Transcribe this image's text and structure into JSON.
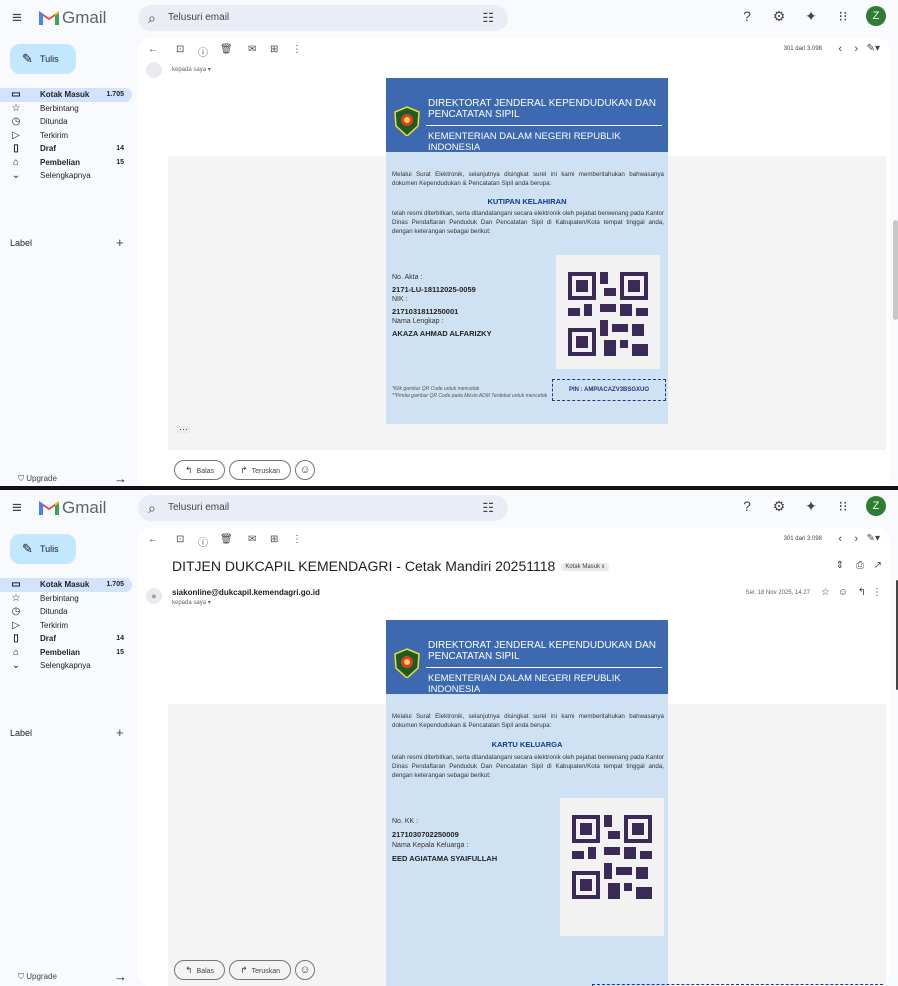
{
  "app": {
    "brand": "Gmail",
    "search_placeholder": "Telusuri email",
    "avatar_letter": "Z",
    "accent": "#c2e7ff",
    "card_blue": "#3d69b1",
    "card_bg": "#cfe2f3"
  },
  "sidebar": {
    "compose": "Tulis",
    "items": [
      {
        "label": "Kotak Masuk",
        "count": "1.705",
        "icon": "inbox-icon"
      },
      {
        "label": "Berbintang",
        "count": "",
        "icon": "star-icon"
      },
      {
        "label": "Ditunda",
        "count": "",
        "icon": "clock-icon"
      },
      {
        "label": "Terkirim",
        "count": "",
        "icon": "send-icon"
      },
      {
        "label": "Draf",
        "count": "14",
        "icon": "draft-icon"
      },
      {
        "label": "Pembelian",
        "count": "15",
        "icon": "shopping-bag-icon"
      },
      {
        "label": "Selengkapnya",
        "count": "",
        "icon": "chevron-down-icon"
      }
    ],
    "label_heading": "Label",
    "upgrade": "Upgrade"
  },
  "toolbar": {
    "pager": "301 dari 3.098"
  },
  "pane1": {
    "sender_to": "kepada saya ▾",
    "card": {
      "title": "DIREKTORAT JENDERAL KEPENDUDUKAN DAN PENCATATAN SIPIL",
      "subtitle": "KEMENTERIAN DALAM NEGERI REPUBLIK INDONESIA",
      "intro": "Melalui Surat Elektronik, selanjutnya disingkat surel ini kami memberitahukan bahwasanya dokumen Kependudukan & Pencatatan Sipil anda berupa:",
      "doc_type": "KUTIPAN KELAHIRAN",
      "body": "telah resmi diterbitkan, serta ditandatangani secara elektronik oleh pejabat berwenang pada Kantor Dinas Pendaftaran Penduduk Dan Pencatatan Sipil di Kabupaten/Kota tempat tinggal anda, dengan keterangan sebagai berikut:",
      "f1_label": "No. Akta :",
      "f1_value": "2171-LU-18112025-0059",
      "f2_label": "NIK :",
      "f2_value": "2171031811250001",
      "f3_label": "Nama Lengkap :",
      "f3_value": "AKAZA AHMAD ALFARIZKY",
      "note1": "*Klik gambar QR Code untuk mencetak",
      "note2": "**Pindai gambar QR Code pada Mesin ADM Terdekat untuk mencetak",
      "pin": "PIN : AMPIACAZV3BSGXUO"
    },
    "reply": "Balas",
    "forward": "Teruskan"
  },
  "pane2": {
    "subject": "DITJEN DUKCAPIL KEMENDAGRI - Cetak Mandiri 20251118",
    "badge": "Kotak Masuk x",
    "sender": "siakonline@dukcapil.kemendagri.go.id",
    "sender_to": "kepada saya ▾",
    "date": "Sel, 18 Nov 2025, 14.27",
    "card": {
      "title": "DIREKTORAT JENDERAL KEPENDUDUKAN DAN PENCATATAN SIPIL",
      "subtitle": "KEMENTERIAN DALAM NEGERI REPUBLIK INDONESIA",
      "intro": "Melalui Surat Elektronik, selanjutnya disingkat surel ini kami memberitahukan bahwasanya dokumen Kependudukan & Pencatatan Sipil anda berupa:",
      "doc_type": "KARTU KELUARGA",
      "body": "telah resmi diterbitkan, serta ditandatangani secara elektronik oleh pejabat berwenang pada Kantor Dinas Pendaftaran Penduduk Dan Pencatatan Sipil di Kabupaten/Kota tempat tinggal anda, dengan keterangan sebagai berikut:",
      "f1_label": "No. KK :",
      "f1_value": "2171030702250009",
      "f2_label": "Nama Kepala Keluarga :",
      "f2_value": "EED AGIATAMA SYAIFULLAH"
    },
    "reply": "Balas",
    "forward": "Teruskan"
  }
}
